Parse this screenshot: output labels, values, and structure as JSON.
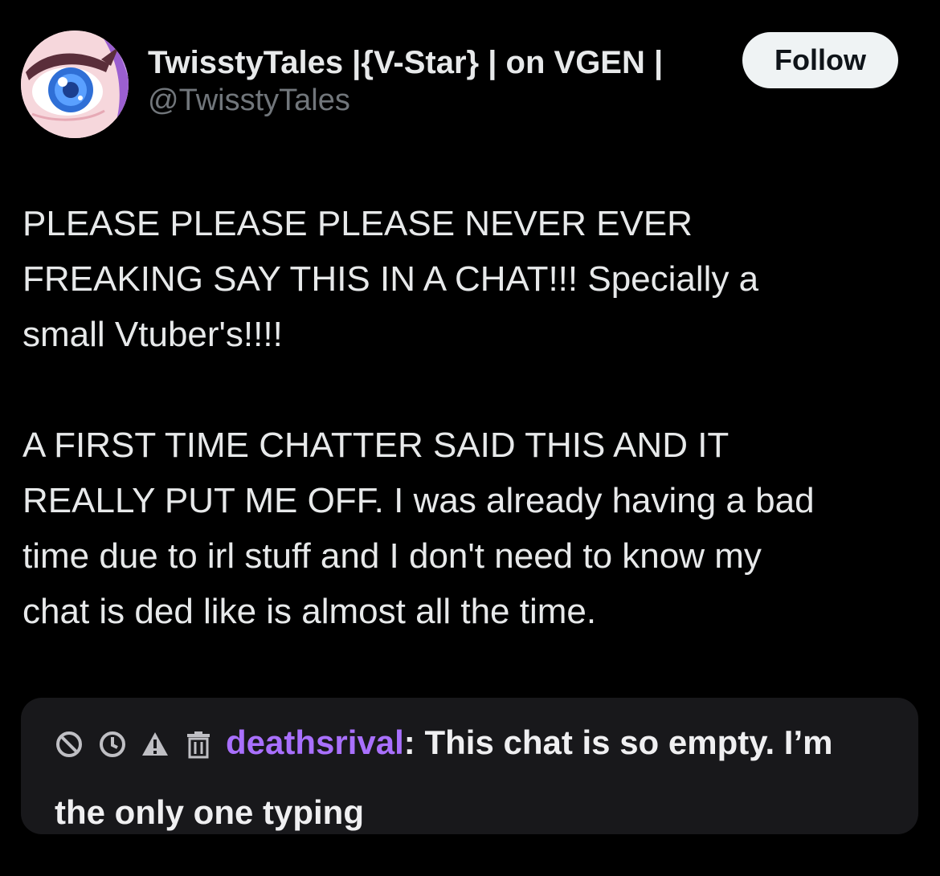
{
  "author": {
    "display_name": "TwisstyTales |{V-Star} | on VGEN |",
    "handle": "@TwisstyTales",
    "avatar_icon": "anime-eye-avatar"
  },
  "follow_button": {
    "label": "Follow"
  },
  "tweet": {
    "paragraphs": [
      "PLEASE PLEASE PLEASE NEVER EVER\nFREAKING SAY THIS IN A CHAT!!! Specially a\nsmall Vtuber's!!!!",
      "A FIRST TIME CHATTER SAID THIS AND IT\nREALLY PUT ME OFF. I was already having a bad\ntime due to irl stuff and I don't need to know my\nchat is ded like is almost all the time."
    ]
  },
  "chat_screenshot": {
    "mod_icons": [
      "ban-icon",
      "timeout-icon",
      "warning-icon",
      "delete-icon"
    ],
    "username": "deathsrival",
    "separator": ":",
    "message": " This chat is so empty. I’m the only one typing",
    "colors": {
      "username": "#a970ff",
      "background": "#18181b",
      "text": "#efeff1"
    }
  },
  "colors": {
    "background": "#000000",
    "text_primary": "#e7e9ea",
    "text_secondary": "#71767b",
    "follow_bg": "#eff3f4"
  }
}
